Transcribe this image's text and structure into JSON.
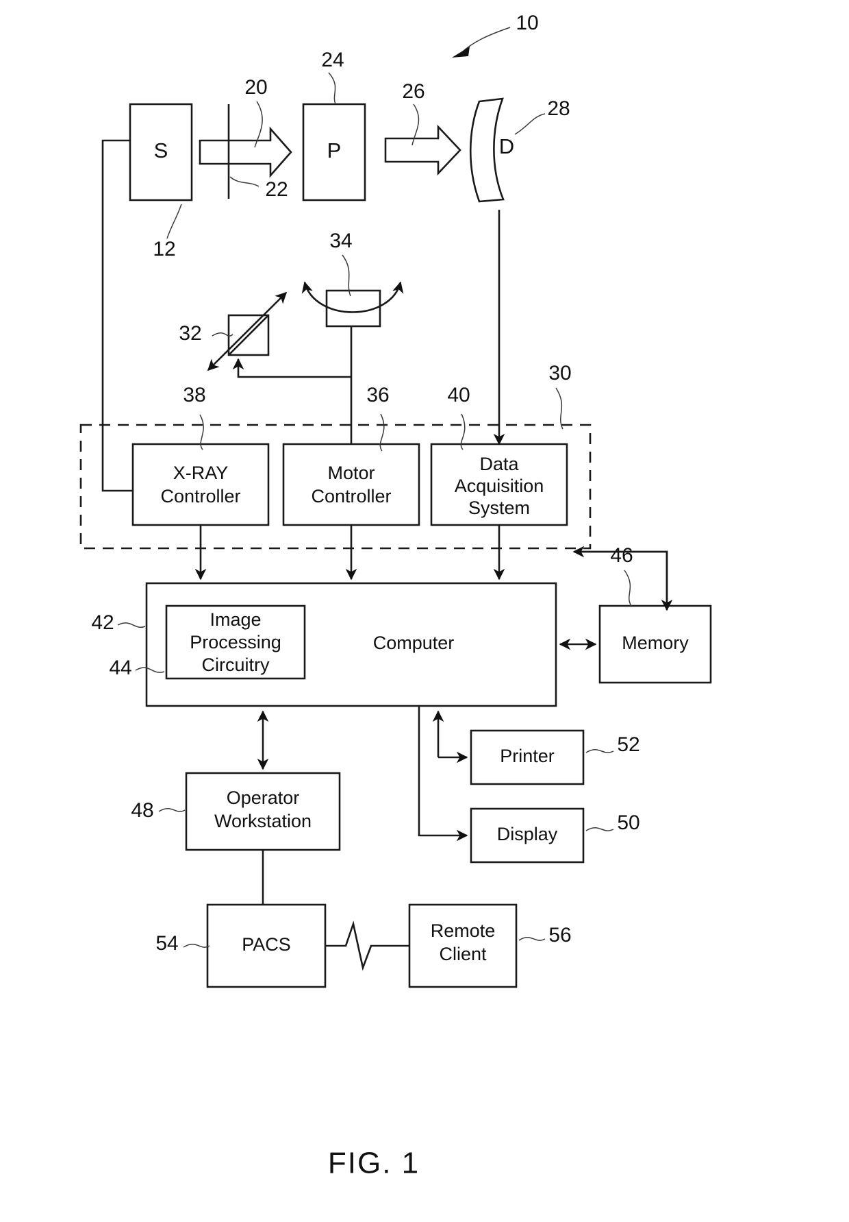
{
  "figure": {
    "caption": "FIG. 1",
    "blocks": {
      "source": "S",
      "patient": "P",
      "detector": "D",
      "xray_controller_line1": "X-RAY",
      "xray_controller_line2": "Controller",
      "motor_controller_line1": "Motor",
      "motor_controller_line2": "Controller",
      "data_acquisition_line1": "Data",
      "data_acquisition_line2": "Acquisition",
      "data_acquisition_line3": "System",
      "computer": "Computer",
      "image_processing_line1": "Image",
      "image_processing_line2": "Processing",
      "image_processing_line3": "Circuitry",
      "memory": "Memory",
      "printer": "Printer",
      "display": "Display",
      "operator_workstation_line1": "Operator",
      "operator_workstation_line2": "Workstation",
      "pacs": "PACS",
      "remote_client_line1": "Remote",
      "remote_client_line2": "Client"
    },
    "reference_numerals": {
      "system": "10",
      "source": "12",
      "beam": "20",
      "collimator": "22",
      "patient": "24",
      "attenuated_beam": "26",
      "detector": "28",
      "system_controller": "30",
      "table": "32",
      "gantry": "34",
      "motor_controller": "36",
      "xray_controller": "38",
      "data_acquisition": "40",
      "computer": "42",
      "image_processing": "44",
      "memory": "46",
      "operator_workstation": "48",
      "display": "50",
      "printer": "52",
      "pacs": "54",
      "remote_client": "56"
    },
    "colors": {
      "ink": "#111111",
      "background": "#ffffff"
    }
  }
}
